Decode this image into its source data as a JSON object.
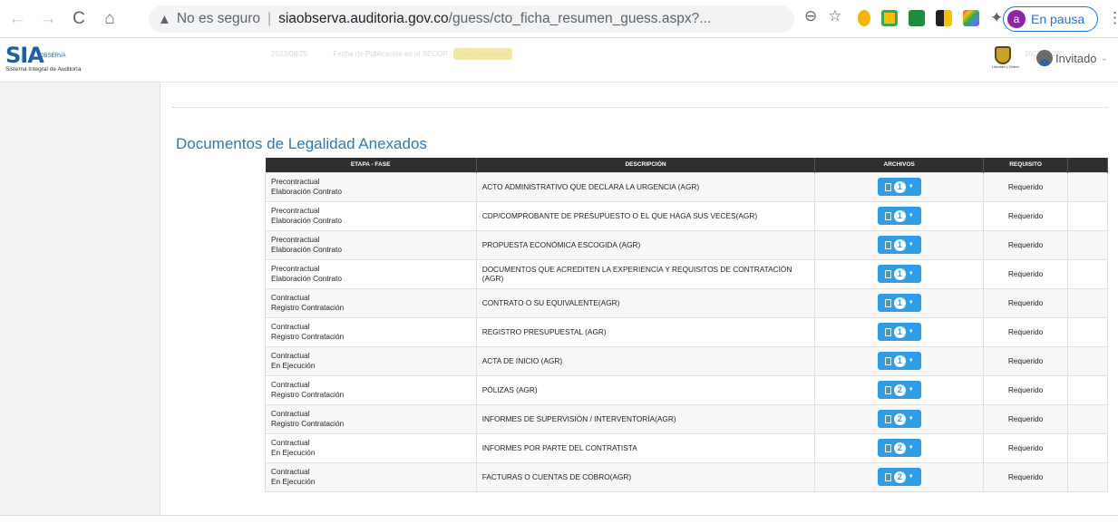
{
  "browser": {
    "back_icon": "←",
    "forward_icon": "→",
    "reload_icon": "C",
    "home_icon": "⌂",
    "warning_icon": "▲",
    "insecure_label": "No es seguro",
    "url_host": "siaobserva.auditoria.gov.co",
    "url_path": "/guess/cto_ficha_resumen_guess.aspx?...",
    "profile_initial": "a",
    "paused_label": "En pausa",
    "menu_icon": "⋮",
    "zoom_icon": "⊖",
    "star_icon": "☆",
    "puzzle_icon": "✦"
  },
  "header": {
    "logo_text": "SIA",
    "logo_sub_brand": "OBSERVA",
    "logo_caption": "Sistema Integral de Auditoría",
    "faded_date": "2022/08/25",
    "faded_pub_label": "Fecha de Publicación en el SECOP",
    "faded_badge": "Ver Publicación",
    "faded_right_date": "2022/08/25",
    "crest_caption": "Libertad y Orden",
    "user_label": "Invitado",
    "user_caret": "⌄"
  },
  "section_title": "Documentos de Legalidad Anexados",
  "table": {
    "headers": [
      "ETAPA - FASE",
      "DESCRIPCIÓN",
      "ARCHIVOS",
      "REQUISITO",
      ""
    ],
    "rows": [
      {
        "etapa": "Precontractual",
        "fase": "Elaboración Contrato",
        "descripcion": "ACTO ADMINISTRATIVO QUE DECLARA LA URGENCIA (AGR)",
        "archivos": "1",
        "requisito": "Requerido"
      },
      {
        "etapa": "Precontractual",
        "fase": "Elaboración Contrato",
        "descripcion": "CDP/COMPROBANTE DE PRESUPUESTO O EL QUE HAGA SUS VECES(AGR)",
        "archivos": "1",
        "requisito": "Requerido"
      },
      {
        "etapa": "Precontractual",
        "fase": "Elaboración Contrato",
        "descripcion": "PROPUESTA ECONÓMICA ESCOGIDA (AGR)",
        "archivos": "1",
        "requisito": "Requerido"
      },
      {
        "etapa": "Precontractual",
        "fase": "Elaboración Contrato",
        "descripcion": "DOCUMENTOS QUE ACREDITEN LA EXPERIENCIA Y REQUISITOS DE CONTRATACIÓN (AGR)",
        "archivos": "1",
        "requisito": "Requerido"
      },
      {
        "etapa": "Contractual",
        "fase": "Registro Contratación",
        "descripcion": "CONTRATO O SU EQUIVALENTE(AGR)",
        "archivos": "1",
        "requisito": "Requerido"
      },
      {
        "etapa": "Contractual",
        "fase": "Registro Contratación",
        "descripcion": "REGISTRO PRESUPUESTAL (AGR)",
        "archivos": "1",
        "requisito": "Requerido"
      },
      {
        "etapa": "Contractual",
        "fase": "En Ejecución",
        "descripcion": "ACTA DE INICIO (AGR)",
        "archivos": "1",
        "requisito": "Requerido"
      },
      {
        "etapa": "Contractual",
        "fase": "Registro Contratación",
        "descripcion": "PÓLIZAS (AGR)",
        "archivos": "2",
        "requisito": "Requerido"
      },
      {
        "etapa": "Contractual",
        "fase": "Registro Contratación",
        "descripcion": "INFORMES DE SUPERVISIÓN / INTERVENTORÍA(AGR)",
        "archivos": "2",
        "requisito": "Requerido"
      },
      {
        "etapa": "Contractual",
        "fase": "En Ejecución",
        "descripcion": "INFORMES POR PARTE DEL CONTRATISTA",
        "archivos": "2",
        "requisito": "Requerido"
      },
      {
        "etapa": "Contractual",
        "fase": "En Ejecución",
        "descripcion": "FACTURAS O CUENTAS DE COBRO(AGR)",
        "archivos": "2",
        "requisito": "Requerido"
      }
    ]
  },
  "colors": {
    "title_blue": "#2a7ab8",
    "button_blue": "#2e9ee9",
    "header_dark": "#2f2f2f"
  }
}
